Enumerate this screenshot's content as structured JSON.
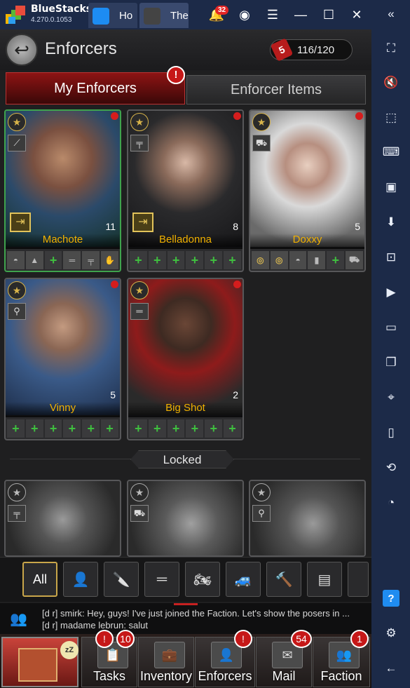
{
  "window": {
    "app_name": "BlueStacks",
    "version": "4.270.0.1053",
    "tabs": [
      {
        "label": "Ho"
      },
      {
        "label": "The"
      }
    ],
    "notification_count": "32"
  },
  "header": {
    "title": "Enforcers",
    "counter": "116/120"
  },
  "tabs": {
    "my_enforcers": "My Enforcers",
    "enforcer_items": "Enforcer Items"
  },
  "enforcers": [
    {
      "name": "Machote",
      "level": "11"
    },
    {
      "name": "Belladonna",
      "level": "8"
    },
    {
      "name": "Doxxy",
      "level": "5"
    },
    {
      "name": "Vinny",
      "level": "5"
    },
    {
      "name": "Big Shot",
      "level": "2"
    }
  ],
  "locked_label": "Locked",
  "filter": {
    "all_label": "All"
  },
  "chat": {
    "line1": "[d r] smirk: Hey, guys! I've just joined the Faction. Let's show the posers in ...",
    "line2": "[d r] madame lebrun: salut"
  },
  "nav": [
    {
      "label": "Tasks",
      "badge": "10"
    },
    {
      "label": "Inventory",
      "badge": ""
    },
    {
      "label": "Enforcers",
      "badge": "!"
    },
    {
      "label": "Mail",
      "badge": "54"
    },
    {
      "label": "Faction",
      "badge": "1"
    }
  ],
  "colors": {
    "accent_red": "#c61818",
    "name_gold": "#f0b000",
    "plus_green": "#3fbf3f",
    "bluestacks_bar": "#1c2a48"
  }
}
